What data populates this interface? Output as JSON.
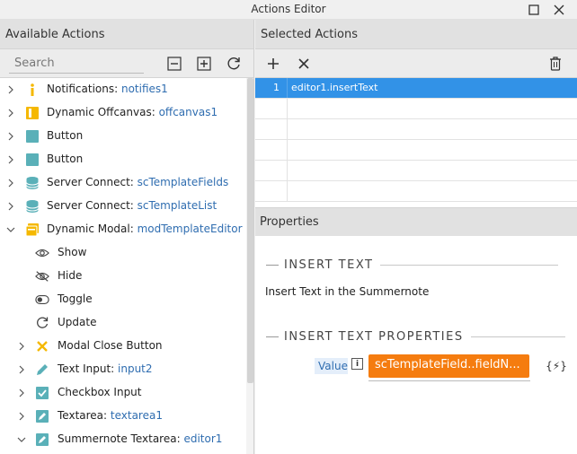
{
  "window": {
    "title": "Actions Editor"
  },
  "left_panel": {
    "header": "Available Actions",
    "search": {
      "placeholder": "Search",
      "value": ""
    },
    "items": [
      {
        "label": "Notifications: ",
        "ref": "notifies1",
        "icon": "info-icon",
        "expanded": false
      },
      {
        "label": "Dynamic Offcanvas: ",
        "ref": "offcanvas1",
        "icon": "offcanvas-icon",
        "expanded": false
      },
      {
        "label": "Button",
        "ref": "",
        "icon": "button-icon",
        "expanded": false
      },
      {
        "label": "Button",
        "ref": "",
        "icon": "button-icon",
        "expanded": false
      },
      {
        "label": "Server Connect: ",
        "ref": "scTemplateFields",
        "icon": "database-icon",
        "expanded": false
      },
      {
        "label": "Server Connect: ",
        "ref": "scTemplateList",
        "icon": "database-icon",
        "expanded": false
      },
      {
        "label": "Dynamic Modal: ",
        "ref": "modTemplateEditor",
        "icon": "modal-icon",
        "expanded": true
      },
      {
        "label": "Show",
        "ref": "",
        "icon": "eye-icon",
        "child": true
      },
      {
        "label": "Hide",
        "ref": "",
        "icon": "eye-off-icon",
        "child": true
      },
      {
        "label": "Toggle",
        "ref": "",
        "icon": "toggle-icon",
        "child": true
      },
      {
        "label": "Update",
        "ref": "",
        "icon": "refresh-icon",
        "child": true
      },
      {
        "label": "Modal Close Button",
        "ref": "",
        "icon": "close-x-icon",
        "expanded": false,
        "sub": true
      },
      {
        "label": "Text Input: ",
        "ref": "input2",
        "icon": "pencil-icon",
        "expanded": false,
        "sub": true
      },
      {
        "label": "Checkbox Input",
        "ref": "",
        "icon": "checkbox-icon",
        "expanded": false,
        "sub": true
      },
      {
        "label": "Textarea: ",
        "ref": "textarea1",
        "icon": "textarea-icon",
        "expanded": false,
        "sub": true
      },
      {
        "label": "Summernote Textarea: ",
        "ref": "editor1",
        "icon": "textarea-icon",
        "expanded": true,
        "sub": true
      }
    ]
  },
  "selected_panel": {
    "header": "Selected Actions",
    "rows": [
      {
        "num": "1",
        "value": "editor1.insertText",
        "selected": true
      },
      {
        "num": "",
        "value": ""
      },
      {
        "num": "",
        "value": ""
      },
      {
        "num": "",
        "value": ""
      },
      {
        "num": "",
        "value": ""
      },
      {
        "num": "",
        "value": ""
      }
    ]
  },
  "properties": {
    "header": "Properties",
    "section1_title": "INSERT TEXT",
    "description": "Insert Text in the Summernote",
    "section2_title": "INSERT TEXT PROPERTIES",
    "value_label": "Value",
    "value": "scTemplateField..fieldN...",
    "dynamic_button": "{⚡}"
  },
  "colors": {
    "accent_blue": "#3292e7",
    "ref_blue": "#2f6db0",
    "value_orange": "#f57c0f",
    "icon_yellow": "#f5b800",
    "icon_teal": "#5ab0b8"
  }
}
